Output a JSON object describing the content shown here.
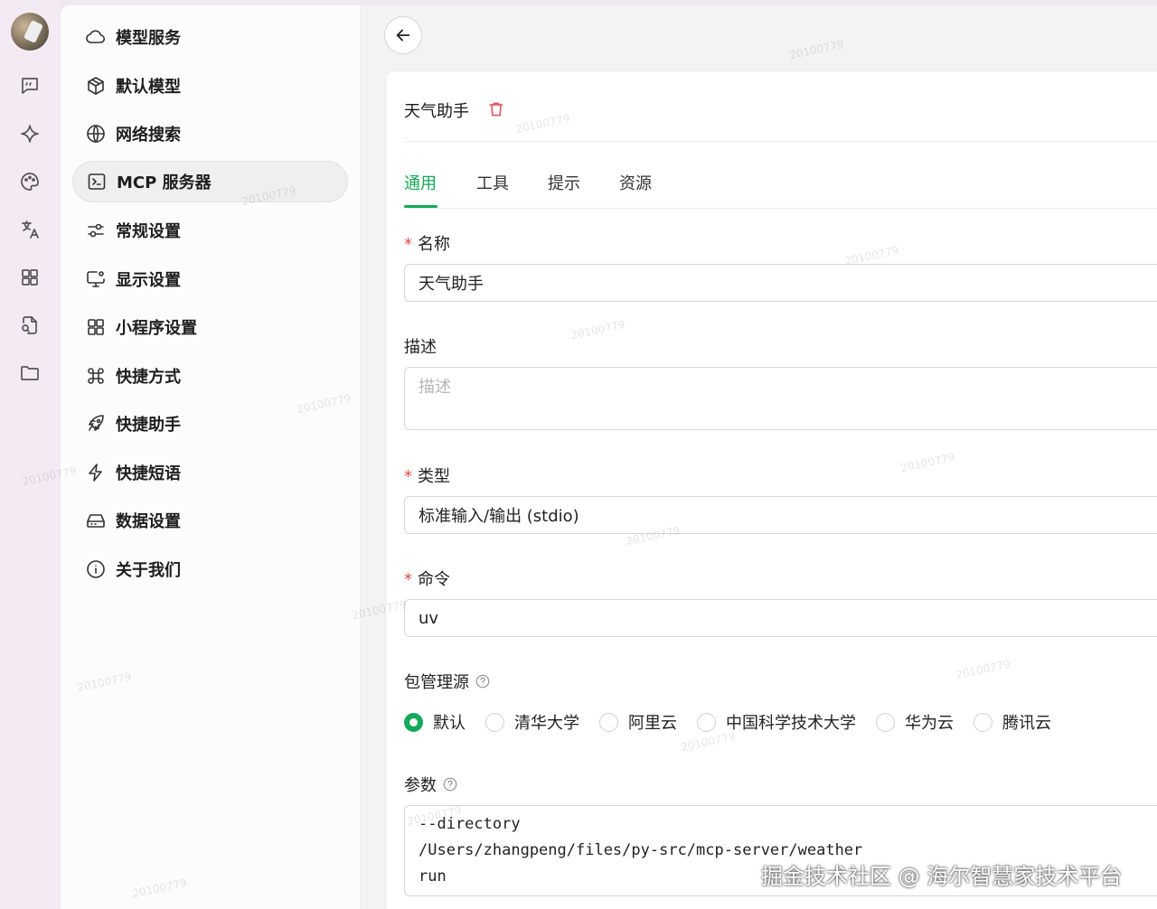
{
  "rail": {
    "icons": [
      "chat-icon",
      "sparkle-icon",
      "palette-icon",
      "translate-icon",
      "apps-icon",
      "document-search-icon",
      "folder-icon"
    ]
  },
  "menu": {
    "items": [
      {
        "label": "模型服务",
        "icon": "cloud-icon",
        "active": false
      },
      {
        "label": "默认模型",
        "icon": "cube-icon",
        "active": false
      },
      {
        "label": "网络搜索",
        "icon": "globe-icon",
        "active": false
      },
      {
        "label": "MCP 服务器",
        "icon": "terminal-icon",
        "active": true
      },
      {
        "label": "常规设置",
        "icon": "sliders-icon",
        "active": false
      },
      {
        "label": "显示设置",
        "icon": "monitor-icon",
        "active": false
      },
      {
        "label": "小程序设置",
        "icon": "grid-icon",
        "active": false
      },
      {
        "label": "快捷方式",
        "icon": "command-icon",
        "active": false
      },
      {
        "label": "快捷助手",
        "icon": "rocket-icon",
        "active": false
      },
      {
        "label": "快捷短语",
        "icon": "zap-icon",
        "active": false
      },
      {
        "label": "数据设置",
        "icon": "drive-icon",
        "active": false
      },
      {
        "label": "关于我们",
        "icon": "info-icon",
        "active": false
      }
    ]
  },
  "server": {
    "title": "天气助手",
    "tabs": [
      "通用",
      "工具",
      "提示",
      "资源"
    ],
    "active_tab": "通用",
    "fields": {
      "name_label": "名称",
      "name_value": "天气助手",
      "desc_label": "描述",
      "desc_placeholder": "描述",
      "type_label": "类型",
      "type_value": "标准输入/输出 (stdio)",
      "command_label": "命令",
      "command_value": "uv",
      "registry_label": "包管理源",
      "args_label": "参数",
      "args_value": "--directory\n/Users/zhangpeng/files/py-src/mcp-server/weather\nrun"
    },
    "registry_options": [
      "默认",
      "清华大学",
      "阿里云",
      "中国科学技术大学",
      "华为云",
      "腾讯云"
    ],
    "registry_selected": "默认"
  },
  "colors": {
    "accent": "#15a85a",
    "danger": "#e5484d"
  },
  "overlay": {
    "watermark": "20100779",
    "footer": "掘金技术社区 @ 海尔智慧家技术平台"
  }
}
